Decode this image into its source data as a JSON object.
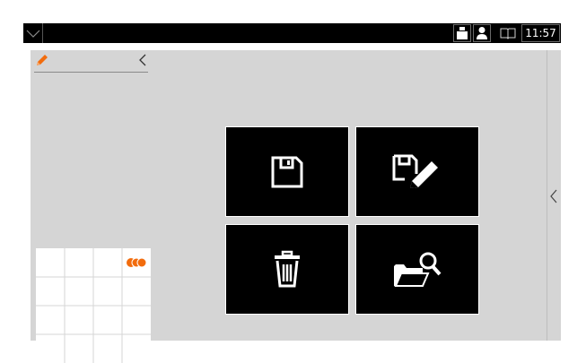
{
  "status_bar": {
    "time": "11:57",
    "icons": [
      "chevron-down-icon",
      "weight-icon",
      "user-icon",
      "book-icon"
    ]
  },
  "panel": {
    "edit_icon": "pencil-icon",
    "collapse_icon": "chevron-left-icon"
  },
  "tiles": [
    {
      "name": "save-tile",
      "icon": "save-icon"
    },
    {
      "name": "save-as-tile",
      "icon": "save-edit-icon"
    },
    {
      "name": "delete-tile",
      "icon": "trash-icon"
    },
    {
      "name": "open-tile",
      "icon": "folder-search-icon"
    }
  ],
  "right_rail": {
    "expand_icon": "chevron-left-icon"
  },
  "colors": {
    "accent": "#f26c0d",
    "status_bar": "#000000",
    "workspace": "#d5d5d5",
    "tile_bg": "#000000"
  }
}
